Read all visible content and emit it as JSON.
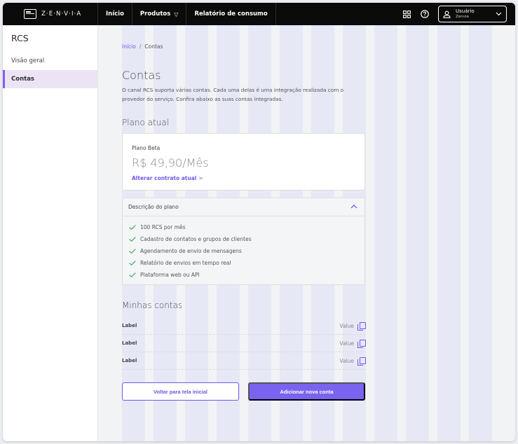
{
  "app": {
    "brand": "Z·E·N·V·I·A"
  },
  "topnav": {
    "items": [
      "Início",
      "Produtos",
      "Relatório de consumo"
    ],
    "user": {
      "name": "Usuário",
      "org": "Zenvia"
    }
  },
  "sidebar": {
    "title": "RCS",
    "items": [
      "Visão geral",
      "Contas"
    ]
  },
  "breadcrumb": {
    "home": "Início",
    "separator": "/",
    "current": "Contas"
  },
  "page": {
    "title": "Contas",
    "description": "O canal RCS suporta várias contas. Cada uma delas é uma integração realizada com o provedor do serviço. Confira abaixo as suas contas integradas."
  },
  "plan": {
    "section_title": "Plano atual",
    "name": "Plano Beta",
    "price": "R$ 49,90/Mês",
    "change_link": "Alterar contrato atual",
    "description_label": "Descrição do plano",
    "features": [
      "100 RCS por mês",
      "Cadastro de contatos e grupos de clientes",
      "Agendamento de envio de mensagens",
      "Relatório de envios em tempo real",
      "Plataforma web ou API"
    ]
  },
  "accounts": {
    "section_title": "Minhas contas",
    "rows": [
      {
        "label": "Label",
        "value": "Value"
      },
      {
        "label": "Label",
        "value": "Value"
      },
      {
        "label": "Label",
        "value": "Value"
      }
    ]
  },
  "actions": {
    "back": "Voltar para tela inicial",
    "add": "Adicionar nova conta"
  },
  "colors": {
    "accent": "#7257e8",
    "active_bg": "#ece4f5",
    "topbar": "#0b0b0b"
  }
}
